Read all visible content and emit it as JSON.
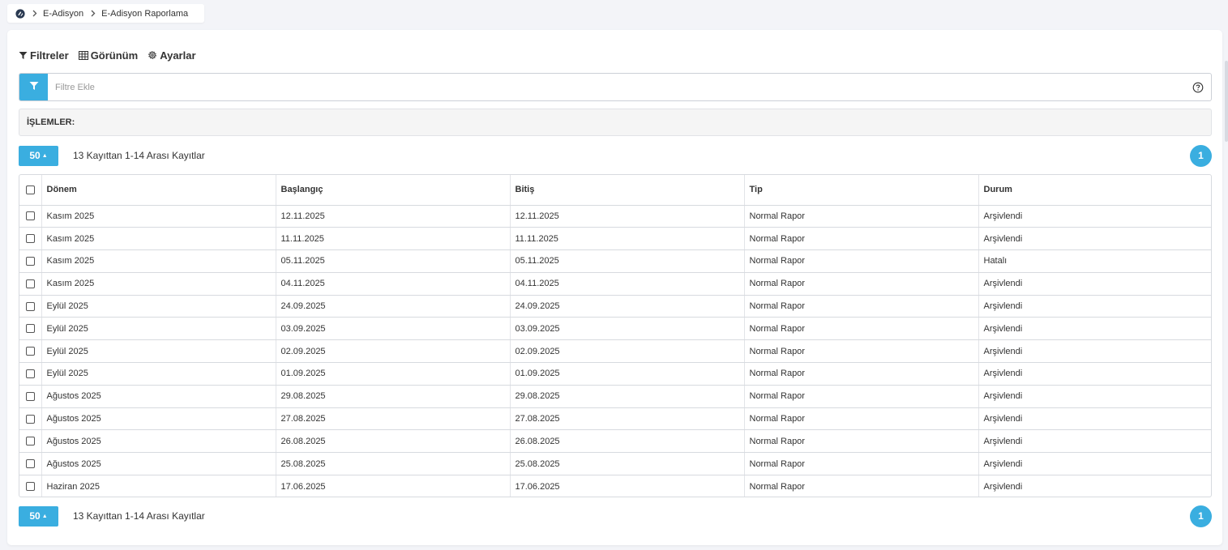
{
  "breadcrumb": {
    "items": [
      "E-Adisyon",
      "E-Adisyon Raporlama"
    ]
  },
  "toolbar": {
    "filters_label": "Filtreler",
    "view_label": "Görünüm",
    "settings_label": "Ayarlar"
  },
  "filter": {
    "placeholder": "Filtre Ekle"
  },
  "operations": {
    "label": "İŞLEMLER:"
  },
  "pagination": {
    "page_size": "50",
    "record_info": "13 Kayıttan 1-14 Arası Kayıtlar",
    "current_page": "1"
  },
  "table": {
    "columns": [
      "Dönem",
      "Başlangıç",
      "Bitiş",
      "Tip",
      "Durum"
    ],
    "rows": [
      [
        "Kasım 2025",
        "12.11.2025",
        "12.11.2025",
        "Normal Rapor",
        "Arşivlendi"
      ],
      [
        "Kasım 2025",
        "11.11.2025",
        "11.11.2025",
        "Normal Rapor",
        "Arşivlendi"
      ],
      [
        "Kasım 2025",
        "05.11.2025",
        "05.11.2025",
        "Normal Rapor",
        "Hatalı"
      ],
      [
        "Kasım 2025",
        "04.11.2025",
        "04.11.2025",
        "Normal Rapor",
        "Arşivlendi"
      ],
      [
        "Eylül 2025",
        "24.09.2025",
        "24.09.2025",
        "Normal Rapor",
        "Arşivlendi"
      ],
      [
        "Eylül 2025",
        "03.09.2025",
        "03.09.2025",
        "Normal Rapor",
        "Arşivlendi"
      ],
      [
        "Eylül 2025",
        "02.09.2025",
        "02.09.2025",
        "Normal Rapor",
        "Arşivlendi"
      ],
      [
        "Eylül 2025",
        "01.09.2025",
        "01.09.2025",
        "Normal Rapor",
        "Arşivlendi"
      ],
      [
        "Ağustos 2025",
        "29.08.2025",
        "29.08.2025",
        "Normal Rapor",
        "Arşivlendi"
      ],
      [
        "Ağustos 2025",
        "27.08.2025",
        "27.08.2025",
        "Normal Rapor",
        "Arşivlendi"
      ],
      [
        "Ağustos 2025",
        "26.08.2025",
        "26.08.2025",
        "Normal Rapor",
        "Arşivlendi"
      ],
      [
        "Ağustos 2025",
        "25.08.2025",
        "25.08.2025",
        "Normal Rapor",
        "Arşivlendi"
      ],
      [
        "Haziran 2025",
        "17.06.2025",
        "17.06.2025",
        "Normal Rapor",
        "Arşivlendi"
      ]
    ]
  },
  "colors": {
    "accent": "#3aaee0",
    "background": "#f3f4f8"
  },
  "icons": {
    "home": "app-logo-icon",
    "separator": "chevron-right-icon",
    "filters": "funnel-icon",
    "view": "grid-icon",
    "settings": "gear-icon",
    "help": "question-circle-icon"
  }
}
